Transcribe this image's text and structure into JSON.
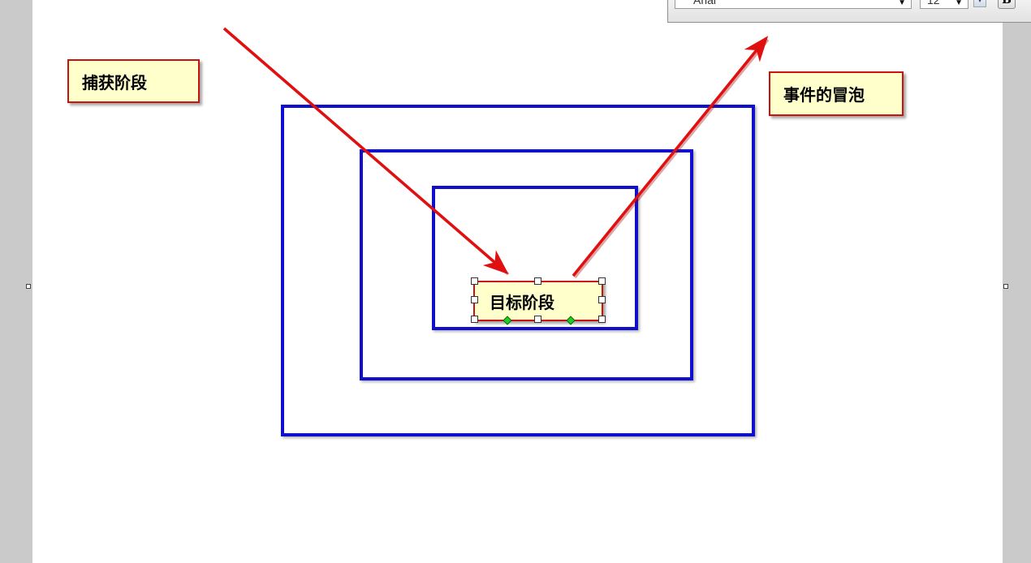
{
  "toolbar": {
    "font_name": "Arial",
    "font_size": "12",
    "bold_label": "B"
  },
  "diagram": {
    "capture_label": "捕获阶段",
    "bubble_label": "事件的冒泡",
    "target_label": "目标阶段"
  },
  "colors": {
    "frame_border": "#1010cc",
    "arrow": "#e01010",
    "callout_fill": "#ffffcc",
    "callout_border": "#cc1111",
    "handle_green": "#22cc22"
  }
}
